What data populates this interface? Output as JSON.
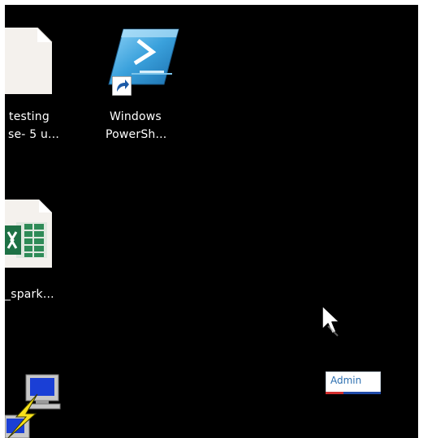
{
  "desktop": {
    "icons": [
      {
        "name": "text-file",
        "line1": "testing",
        "line2": "se- 5 u..."
      },
      {
        "name": "windows-powershell",
        "line1": "Windows",
        "line2": "PowerSh..."
      },
      {
        "name": "excel-file",
        "line1": "_spark..."
      },
      {
        "name": "network-connection",
        "line1": ""
      }
    ]
  },
  "tag": {
    "label": "Admin"
  },
  "colors": {
    "background": "#000000",
    "label_text": "#ffffff",
    "admin_text": "#2c6fb0",
    "powershell_blue": "#3aa1dc",
    "excel_green": "#1e7145"
  }
}
